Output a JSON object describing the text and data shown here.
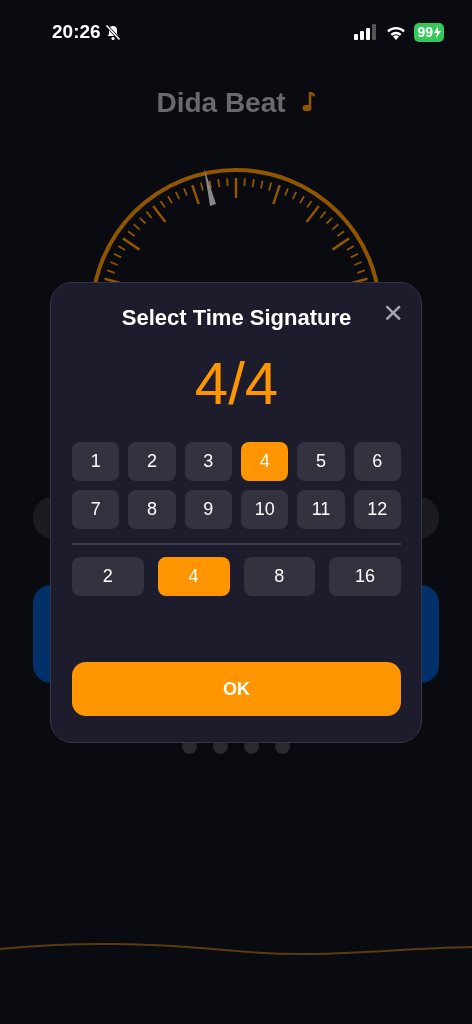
{
  "status_bar": {
    "time": "20:26",
    "battery": "99"
  },
  "app_title": "Dida Beat",
  "dialog": {
    "title": "Select Time Signature",
    "close": "×",
    "current": "4/4",
    "beats": [
      {
        "label": "1",
        "selected": false
      },
      {
        "label": "2",
        "selected": false
      },
      {
        "label": "3",
        "selected": false
      },
      {
        "label": "4",
        "selected": true
      },
      {
        "label": "5",
        "selected": false
      },
      {
        "label": "6",
        "selected": false
      },
      {
        "label": "7",
        "selected": false
      },
      {
        "label": "8",
        "selected": false
      },
      {
        "label": "9",
        "selected": false
      },
      {
        "label": "10",
        "selected": false
      },
      {
        "label": "11",
        "selected": false
      },
      {
        "label": "12",
        "selected": false
      }
    ],
    "note_values": [
      {
        "label": "2",
        "selected": false
      },
      {
        "label": "4",
        "selected": true
      },
      {
        "label": "8",
        "selected": false
      },
      {
        "label": "16",
        "selected": false
      }
    ],
    "ok_button": "OK"
  }
}
